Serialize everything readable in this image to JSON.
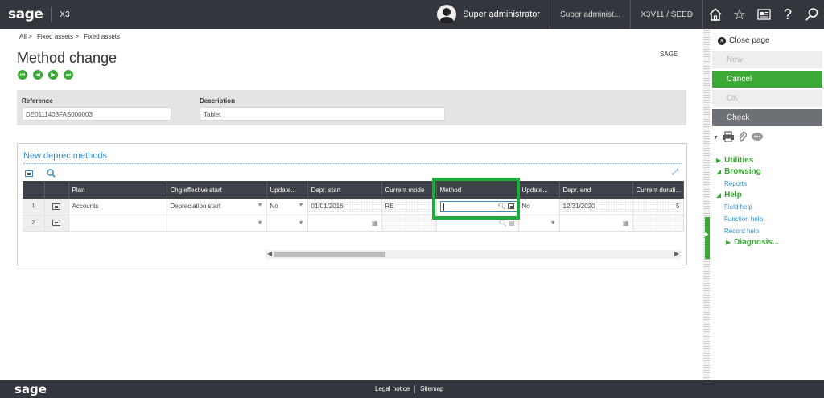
{
  "topbar": {
    "logo": "sage",
    "product": "X3",
    "user": "Super administrator",
    "role": "Super administ...",
    "folder": "X3V11 / SEED"
  },
  "breadcrumb": [
    "All >",
    "Fixed assets >",
    "Fixed assets"
  ],
  "page": {
    "title": "Method change",
    "company": "SAGE"
  },
  "nav_icons": [
    "first-icon",
    "previous-icon",
    "next-icon",
    "last-icon"
  ],
  "header": {
    "reference_label": "Reference",
    "reference_value": "DE0111403FAS000003",
    "description_label": "Description",
    "description_value": "Tablet"
  },
  "grid": {
    "title": "New deprec methods",
    "columns": [
      "Plan",
      "Chg effective start",
      "Update...",
      "Depr. start",
      "Current mode",
      "Method",
      "Update...",
      "Depr. end",
      "Current durati..."
    ],
    "rows": [
      {
        "num": "1",
        "plan": "Accounts",
        "chg_effective_start": "Depreciation start",
        "update1": "No",
        "depr_start": "01/01/2016",
        "current_mode": "RE",
        "method": "",
        "update2": "No",
        "depr_end": "12/31/2020",
        "current_duration": "5"
      },
      {
        "num": "2",
        "plan": "",
        "chg_effective_start": "",
        "update1": "",
        "depr_start": "",
        "current_mode": "",
        "method": "",
        "update2": "",
        "depr_end": "",
        "current_duration": ""
      }
    ]
  },
  "sidebar": {
    "close_page": "Close page",
    "buttons": {
      "new": "New",
      "cancel": "Cancel",
      "ok": "OK",
      "check": "Check"
    },
    "menus": {
      "utilities": "Utilities",
      "browsing": "Browsing",
      "reports": "Reports",
      "help": "Help",
      "field_help": "Field help",
      "function_help": "Function help",
      "record_help": "Record help",
      "diagnosis": "Diagnosis..."
    }
  },
  "footer": {
    "logo": "sage",
    "legal": "Legal notice",
    "sitemap": "Sitemap"
  },
  "colors": {
    "accent_green": "#3aa935",
    "link_blue": "#2f8ec9",
    "topbar": "#33373d",
    "highlight": "#1faa3c"
  }
}
